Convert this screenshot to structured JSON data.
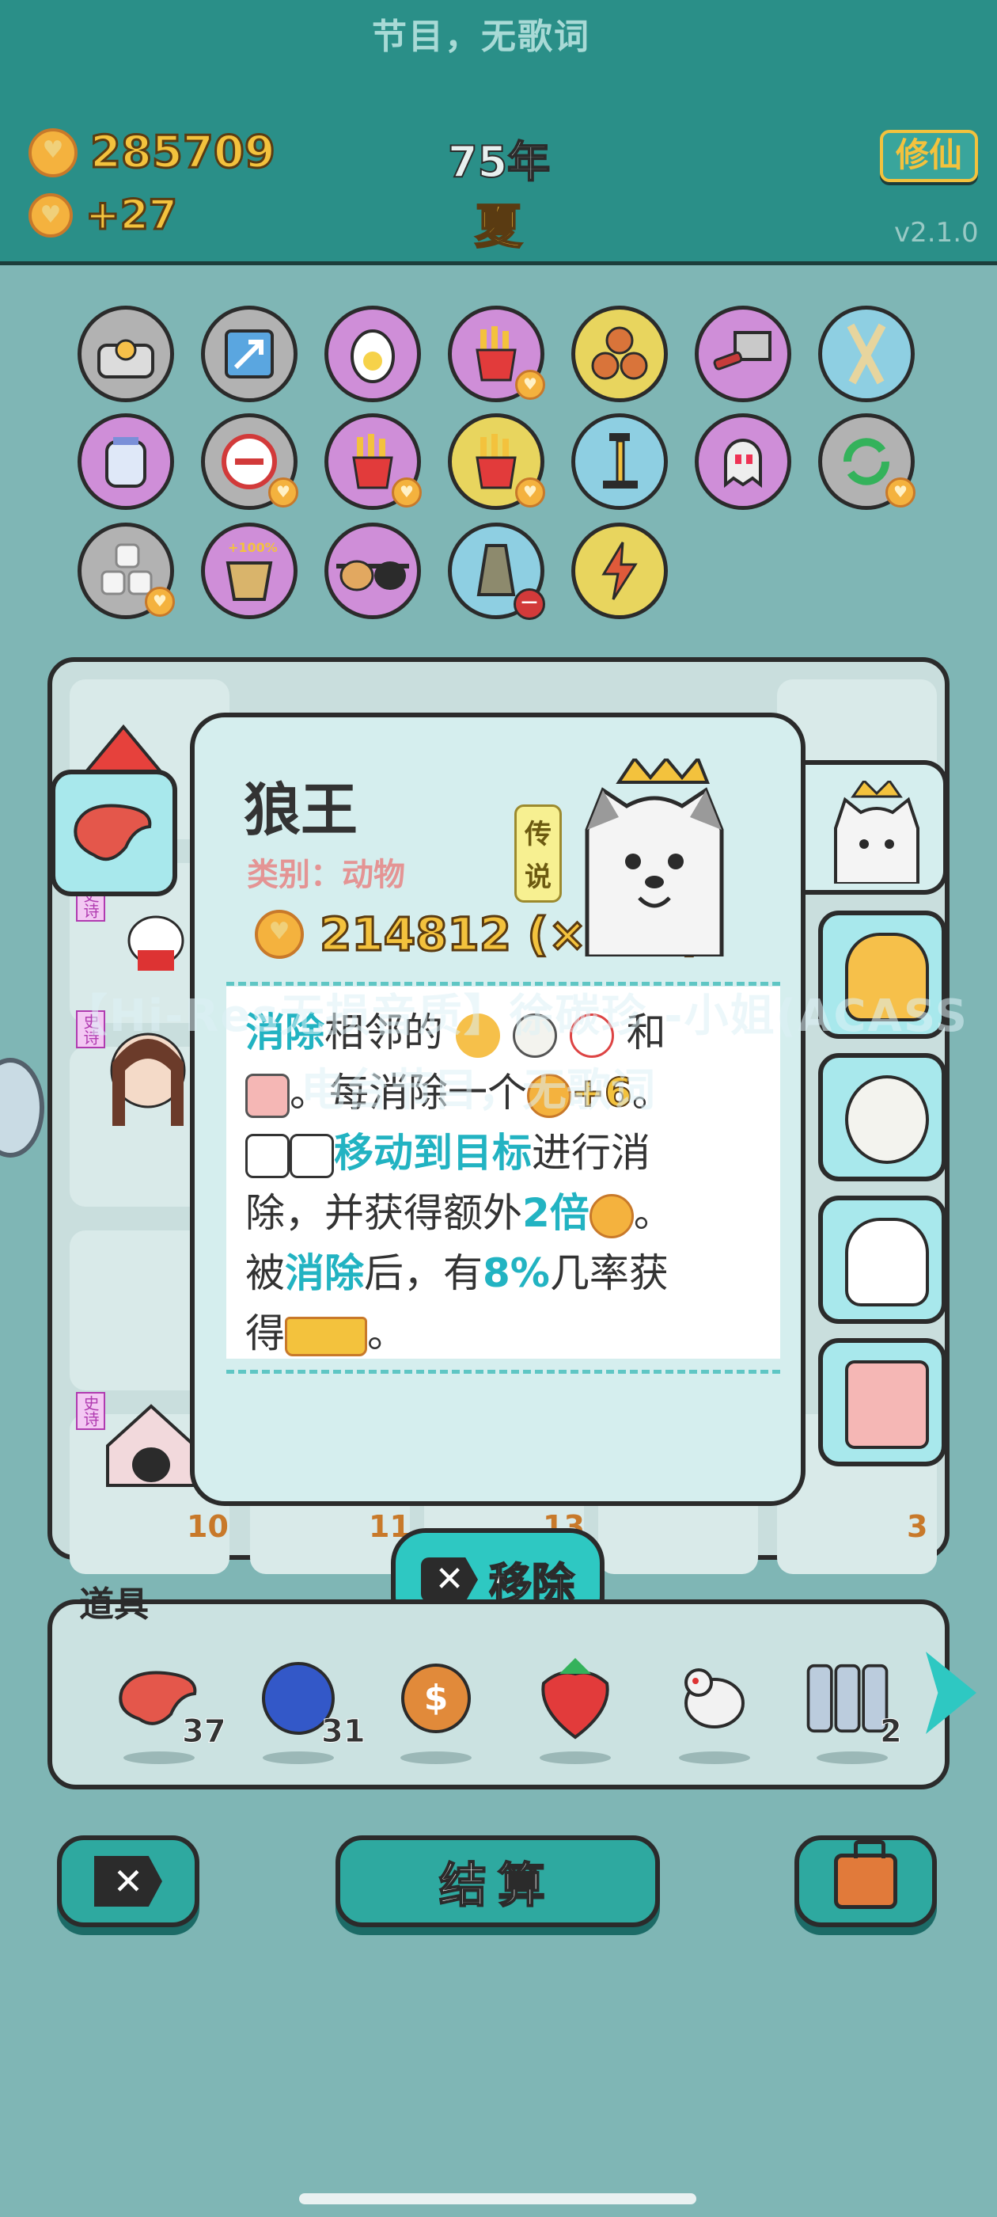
{
  "header": {
    "marquee": "节目，无歌词",
    "coins": "285709",
    "income": "+27",
    "year": "75年",
    "season": "夏",
    "xiu_button": "修仙",
    "version": "v2.1.0"
  },
  "badges": {
    "hundred": "+100%"
  },
  "board": {
    "slot_numbers": [
      "10",
      "11",
      "13",
      "3"
    ],
    "tags": [
      "史诗",
      "史诗",
      "史诗",
      "传"
    ]
  },
  "popup": {
    "name": "狼王",
    "category": "类别：动物",
    "rarity": "传说",
    "value": "214812 (×918)",
    "desc": {
      "l1a": "消除",
      "l1b": "相邻的",
      "l1c": "和",
      "l2a": "。每消除一个",
      "l2b": "+6",
      "l2c": "。",
      "l3a": "移动到目标",
      "l3b": "进行消",
      "l4a": "除，并获得额外",
      "l4b": "2倍",
      "l4c": "。",
      "l5a": "被",
      "l5b": "消除",
      "l5c": "后，有",
      "l5d": "8%",
      "l5e": "几率获",
      "l6a": "得",
      "l6b": "。"
    }
  },
  "remove_button": "移除",
  "props": {
    "title": "道具",
    "items": [
      {
        "name": "liver",
        "count": "37"
      },
      {
        "name": "blueberry",
        "count": "31"
      },
      {
        "name": "coin-dollar",
        "count": ""
      },
      {
        "name": "strawberry",
        "count": ""
      },
      {
        "name": "dove",
        "count": ""
      },
      {
        "name": "scroll",
        "count": "2"
      }
    ]
  },
  "bottom": {
    "settle": "结算"
  },
  "watermark": {
    "line1": "【Hi-Res无损音质】徐碳珍 -小姐(ACASS",
    "line2": "电台节目，无歌词"
  },
  "colors": {
    "header": "#2a8f88",
    "accent": "#2ec8c2",
    "gold": "#f3c23d",
    "highlight_text": "#22b3c2"
  }
}
